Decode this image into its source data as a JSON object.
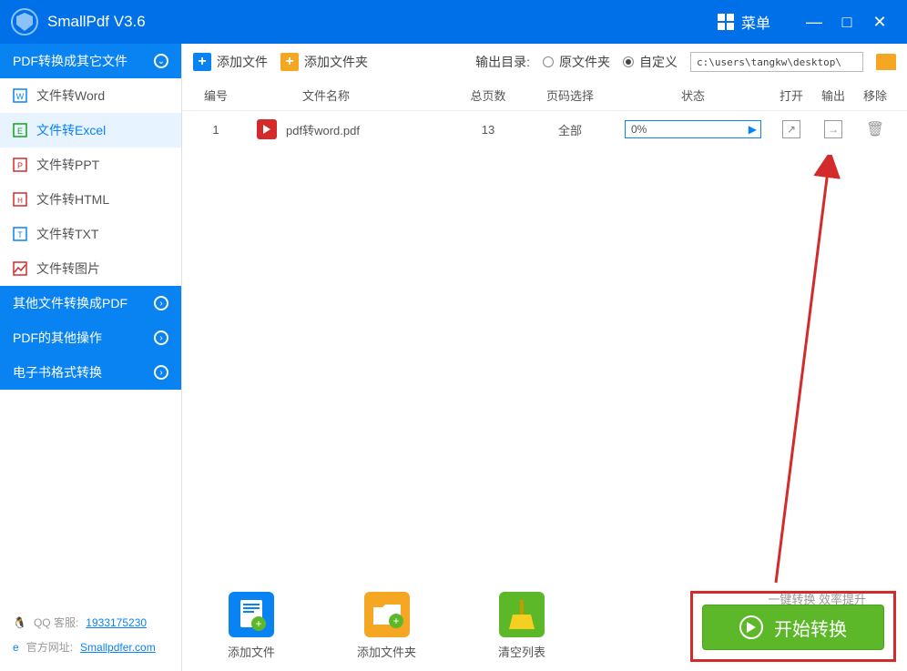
{
  "app": {
    "title": "SmallPdf V3.6",
    "menu_label": "菜单"
  },
  "sidebar": {
    "cat1": "PDF转换成其它文件",
    "items": [
      {
        "label": "文件转Word",
        "color": "#0a83f2"
      },
      {
        "label": "文件转Excel",
        "color": "#1aa01a"
      },
      {
        "label": "文件转PPT",
        "color": "#d32b2b"
      },
      {
        "label": "文件转HTML",
        "color": "#d32b2b"
      },
      {
        "label": "文件转TXT",
        "color": "#0a83f2"
      },
      {
        "label": "文件转图片",
        "color": "#d32b2b"
      }
    ],
    "cat2": "其他文件转换成PDF",
    "cat3": "PDF的其他操作",
    "cat4": "电子书格式转换",
    "footer": {
      "qq_label": "QQ 客服:",
      "qq": "1933175230",
      "site_label": "官方网址:",
      "site": "Smallpdfer.com"
    }
  },
  "toolbar": {
    "add_file": "添加文件",
    "add_folder": "添加文件夹",
    "output_dir": "输出目录:",
    "radio_src": "原文件夹",
    "radio_custom": "自定义",
    "path": "c:\\users\\tangkw\\desktop\\"
  },
  "table": {
    "head": {
      "num": "编号",
      "name": "文件名称",
      "pages": "总页数",
      "sel": "页码选择",
      "status": "状态",
      "open": "打开",
      "out": "输出",
      "del": "移除"
    },
    "rows": [
      {
        "num": "1",
        "name": "pdf转word.pdf",
        "pages": "13",
        "sel": "全部",
        "progress": "0%"
      }
    ]
  },
  "bottom": {
    "add_file": "添加文件",
    "add_folder": "添加文件夹",
    "clear": "清空列表",
    "hint": "一键转换  效率提升",
    "start": "开始转换"
  }
}
